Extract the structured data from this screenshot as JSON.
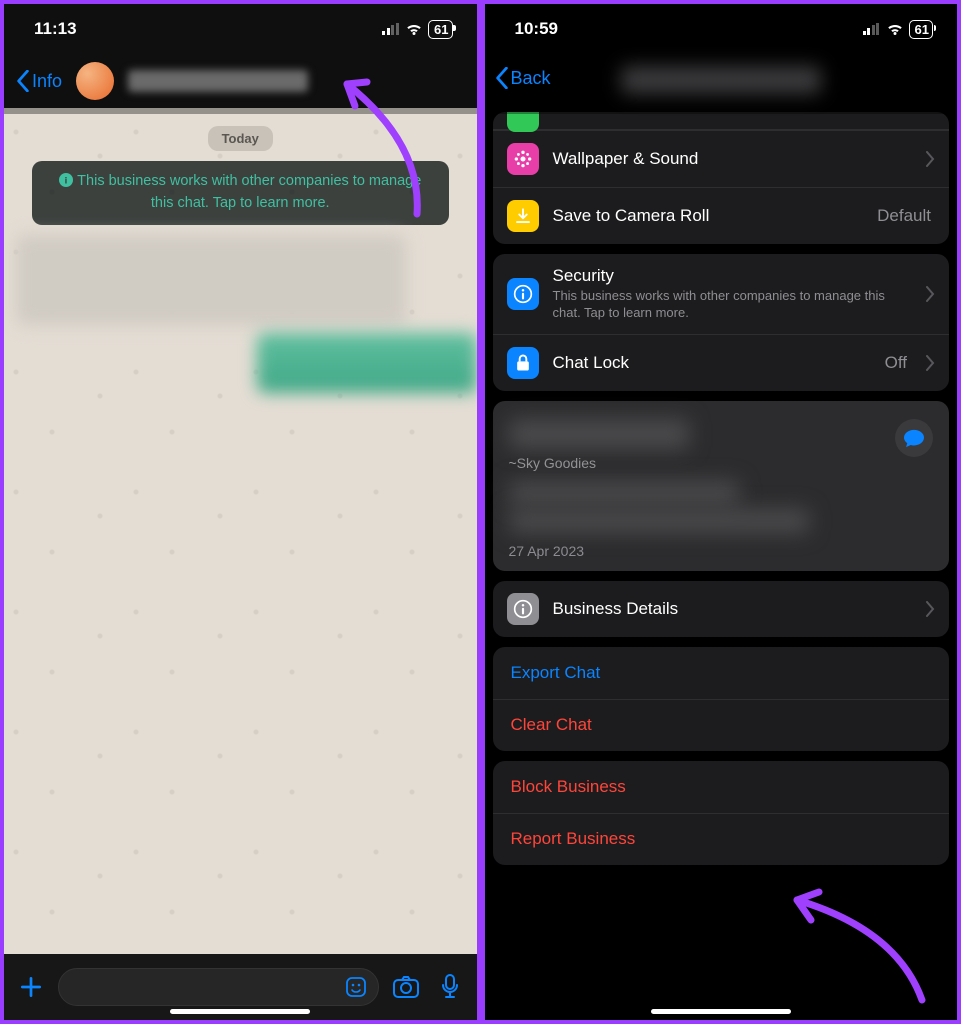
{
  "left": {
    "status": {
      "time": "11:13",
      "battery": "61"
    },
    "backLabel": "Info",
    "datePill": "Today",
    "infoBubble": "This business works with other companies to manage this chat. Tap to learn more.",
    "avatarText": ""
  },
  "right": {
    "status": {
      "time": "10:59",
      "battery": "61"
    },
    "backLabel": "Back",
    "rows": {
      "wallpaper": "Wallpaper & Sound",
      "save": "Save to Camera Roll",
      "saveValue": "Default",
      "security": "Security",
      "securitySub": "This business works with other companies to manage this chat. Tap to learn more.",
      "chatlock": "Chat Lock",
      "chatlockValue": "Off",
      "businessDetails": "Business Details",
      "export": "Export Chat",
      "clear": "Clear Chat",
      "block": "Block Business",
      "report": "Report Business"
    },
    "profile": {
      "subname": "~Sky Goodies",
      "date": "27 Apr 2023"
    }
  }
}
